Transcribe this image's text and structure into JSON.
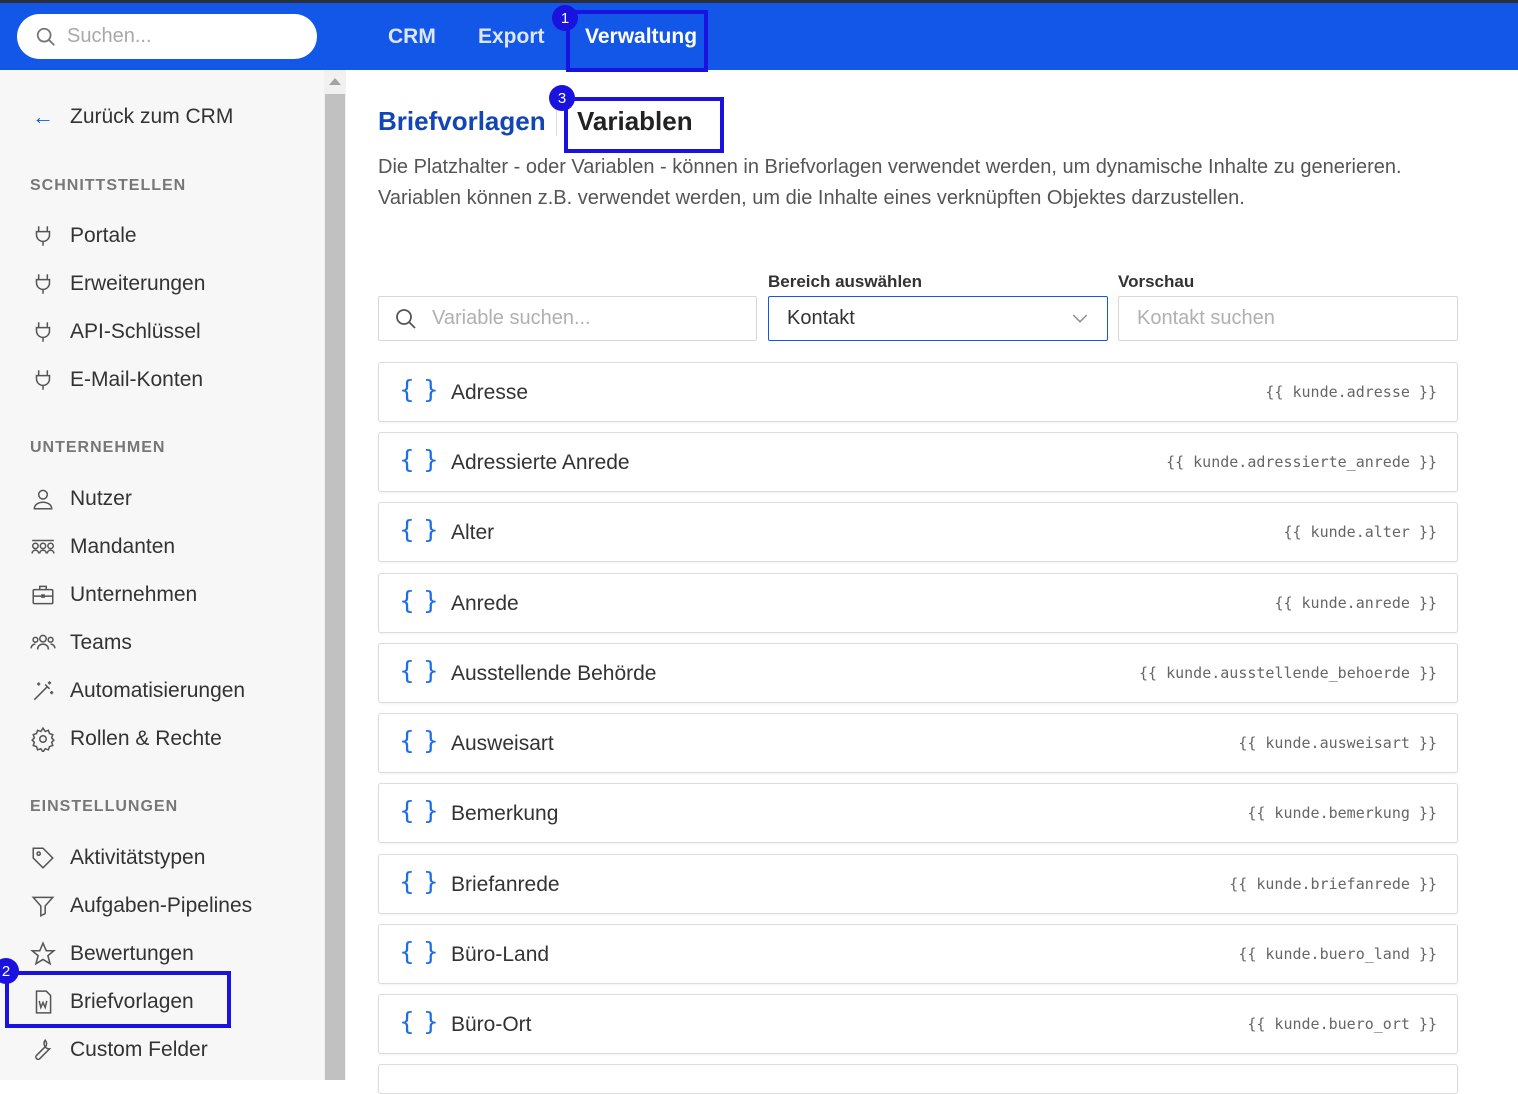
{
  "search": {
    "placeholder": "Suchen..."
  },
  "nav": {
    "crm": "CRM",
    "export": "Export",
    "verwaltung": "Verwaltung"
  },
  "badges": {
    "b1": "1",
    "b2": "2",
    "b3": "3"
  },
  "sidebar": {
    "back": "Zurück zum CRM",
    "sections": [
      "SCHNITTSTELLEN",
      "UNTERNEHMEN",
      "EINSTELLUNGEN"
    ],
    "items": [
      {
        "label": "Portale",
        "icon": "plug-icon"
      },
      {
        "label": "Erweiterungen",
        "icon": "plug-icon"
      },
      {
        "label": "API-Schlüssel",
        "icon": "plug-icon"
      },
      {
        "label": "E-Mail-Konten",
        "icon": "plug-icon"
      },
      {
        "label": "Nutzer",
        "icon": "user-icon"
      },
      {
        "label": "Mandanten",
        "icon": "group-icon"
      },
      {
        "label": "Unternehmen",
        "icon": "briefcase-icon"
      },
      {
        "label": "Teams",
        "icon": "team-icon"
      },
      {
        "label": "Automatisierungen",
        "icon": "magic-wand-icon"
      },
      {
        "label": "Rollen & Rechte",
        "icon": "gear-icon"
      },
      {
        "label": "Aktivitätstypen",
        "icon": "tag-icon"
      },
      {
        "label": "Aufgaben-Pipelines",
        "icon": "filter-icon"
      },
      {
        "label": "Bewertungen",
        "icon": "star-icon"
      },
      {
        "label": "Briefvorlagen",
        "icon": "word-document-icon"
      },
      {
        "label": "Custom Felder",
        "icon": "wrench-icon"
      }
    ]
  },
  "main": {
    "tabs": [
      "Briefvorlagen",
      "Variablen"
    ],
    "description": "Die Platzhalter - oder Variablen - können in Briefvorlagen verwendet werden, um dynamische Inhalte zu generieren. Variablen können z.B. verwendet werden, um die Inhalte eines verknüpften Objektes darzustellen.",
    "variable_search_placeholder": "Variable suchen...",
    "bereich_label": "Bereich auswählen",
    "bereich_value": "Kontakt",
    "vorschau_label": "Vorschau",
    "vorschau_placeholder": "Kontakt suchen",
    "variables": [
      {
        "name": "Adresse",
        "code": "{{ kunde.adresse }}"
      },
      {
        "name": "Adressierte Anrede",
        "code": "{{ kunde.adressierte_anrede }}"
      },
      {
        "name": "Alter",
        "code": "{{ kunde.alter }}"
      },
      {
        "name": "Anrede",
        "code": "{{ kunde.anrede }}"
      },
      {
        "name": "Ausstellende Behörde",
        "code": "{{ kunde.ausstellende_behoerde }}"
      },
      {
        "name": "Ausweisart",
        "code": "{{ kunde.ausweisart }}"
      },
      {
        "name": "Bemerkung",
        "code": "{{ kunde.bemerkung }}"
      },
      {
        "name": "Briefanrede",
        "code": "{{ kunde.briefanrede }}"
      },
      {
        "name": "Büro-Land",
        "code": "{{ kunde.buero_land }}"
      },
      {
        "name": "Büro-Ort",
        "code": "{{ kunde.buero_ort }}"
      }
    ]
  },
  "colors": {
    "brand": "#1257e8",
    "annotation": "#1a13e0",
    "brace": "#1e6ee8"
  }
}
